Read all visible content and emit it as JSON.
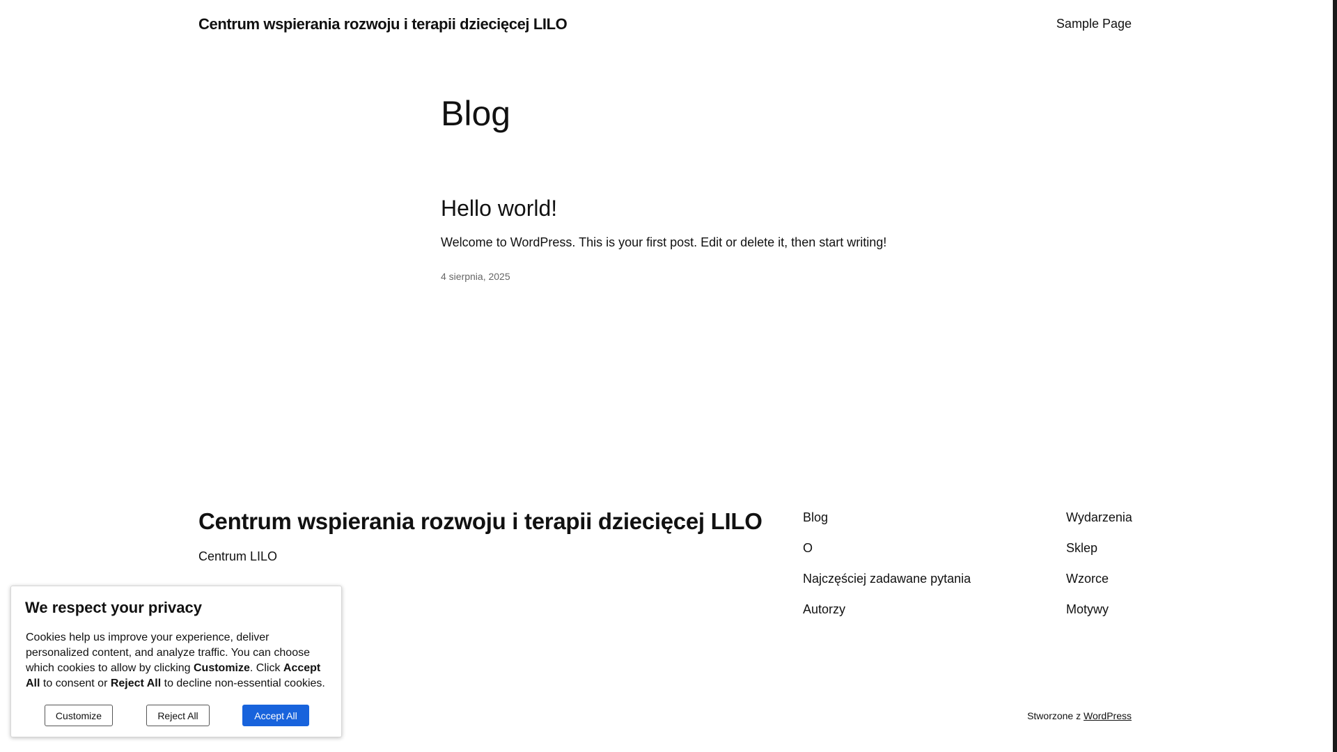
{
  "header": {
    "site_title": "Centrum wspierania rozwoju i terapii dziecięcej LILO",
    "nav": [
      {
        "label": "Sample Page"
      }
    ]
  },
  "main": {
    "heading": "Blog",
    "posts": [
      {
        "title": "Hello world!",
        "excerpt": "Welcome to WordPress. This is your first post. Edit or delete it, then start writing!",
        "date": "4 sierpnia, 2025"
      }
    ]
  },
  "footer": {
    "site_title": "Centrum wspierania rozwoju i terapii dziecięcej LILO",
    "tagline": "Centrum LILO",
    "nav_columns": [
      [
        {
          "label": "Blog"
        },
        {
          "label": "O"
        },
        {
          "label": "Najczęściej zadawane pytania"
        },
        {
          "label": "Autorzy"
        }
      ],
      [
        {
          "label": "Wydarzenia"
        },
        {
          "label": "Sklep"
        },
        {
          "label": "Wzorce"
        },
        {
          "label": "Motywy"
        }
      ]
    ],
    "credits_prefix": "Stworzone z",
    "credits_link": "WordPress"
  },
  "cookie_banner": {
    "title": "We respect your privacy",
    "text_1": "Cookies help us improve your experience, deliver personalized content, and analyze traffic. You can choose which cookies to allow by clicking ",
    "bold_customize": "Customize",
    "text_2": ". Click ",
    "bold_accept": "Accept All",
    "text_3": " to consent or ",
    "bold_reject": "Reject All",
    "text_4": " to decline non-essential cookies.",
    "buttons": {
      "customize": "Customize",
      "reject": "Reject All",
      "accept": "Accept All"
    },
    "accent_color": "#1863dc"
  }
}
